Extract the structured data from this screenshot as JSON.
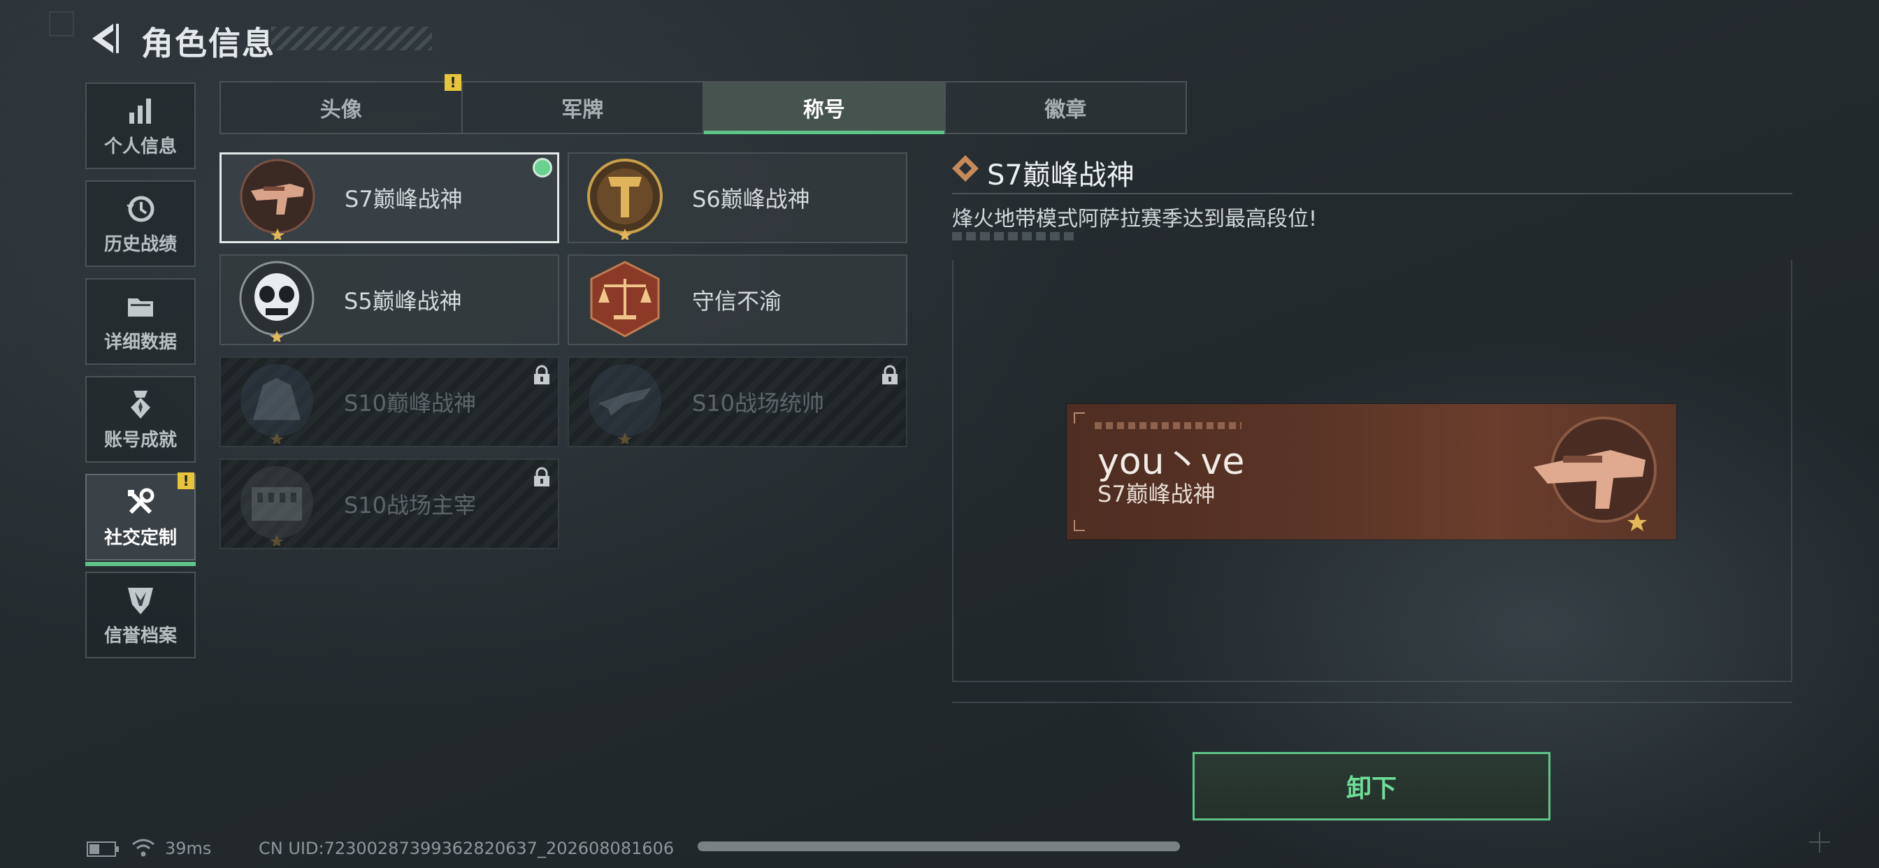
{
  "header": {
    "title": "角色信息"
  },
  "sidebar": {
    "items": [
      {
        "label": "个人信息",
        "icon": "bar-chart-icon"
      },
      {
        "label": "历史战绩",
        "icon": "history-clock-icon"
      },
      {
        "label": "详细数据",
        "icon": "folder-icon"
      },
      {
        "label": "账号成就",
        "icon": "medal-icon"
      },
      {
        "label": "社交定制",
        "icon": "tools-icon",
        "active": true,
        "badge": "!"
      },
      {
        "label": "信誉档案",
        "icon": "shield-emblem-icon"
      }
    ]
  },
  "tabs": [
    {
      "label": "头像",
      "badge": "!"
    },
    {
      "label": "军牌"
    },
    {
      "label": "称号",
      "active": true
    },
    {
      "label": "徽章"
    }
  ],
  "titles": [
    {
      "name": "S7巅峰战神",
      "selected": true,
      "equipped": true,
      "locked": false,
      "icon": "smg-emblem-icon"
    },
    {
      "name": "S6巅峰战神",
      "selected": false,
      "locked": false,
      "icon": "golden-helmet-emblem-icon"
    },
    {
      "name": "S5巅峰战神",
      "selected": false,
      "locked": false,
      "icon": "skull-mask-emblem-icon"
    },
    {
      "name": "守信不渝",
      "selected": false,
      "locked": false,
      "icon": "scales-emblem-icon"
    },
    {
      "name": "S10巅峰战神",
      "selected": false,
      "locked": true,
      "icon": "building-emblem-icon"
    },
    {
      "name": "S10战场统帅",
      "selected": false,
      "locked": true,
      "icon": "aircraft-emblem-icon"
    },
    {
      "name": "S10战场主宰",
      "selected": false,
      "locked": true,
      "icon": "colosseum-emblem-icon"
    }
  ],
  "detail": {
    "title": "S7巅峰战神",
    "description": "烽火地带模式阿萨拉赛季达到最高段位!"
  },
  "nameplate": {
    "player_name": "you丶ve",
    "title": "S7巅峰战神"
  },
  "actions": {
    "unequip_label": "卸下"
  },
  "footer": {
    "ping": "39ms",
    "uid": "CN UID:7230028739936282063​7_202608081606"
  },
  "colors": {
    "accent_green": "#5fc48a",
    "warning_yellow": "#e8c43a",
    "nameplate_brown": "#5a3426"
  }
}
